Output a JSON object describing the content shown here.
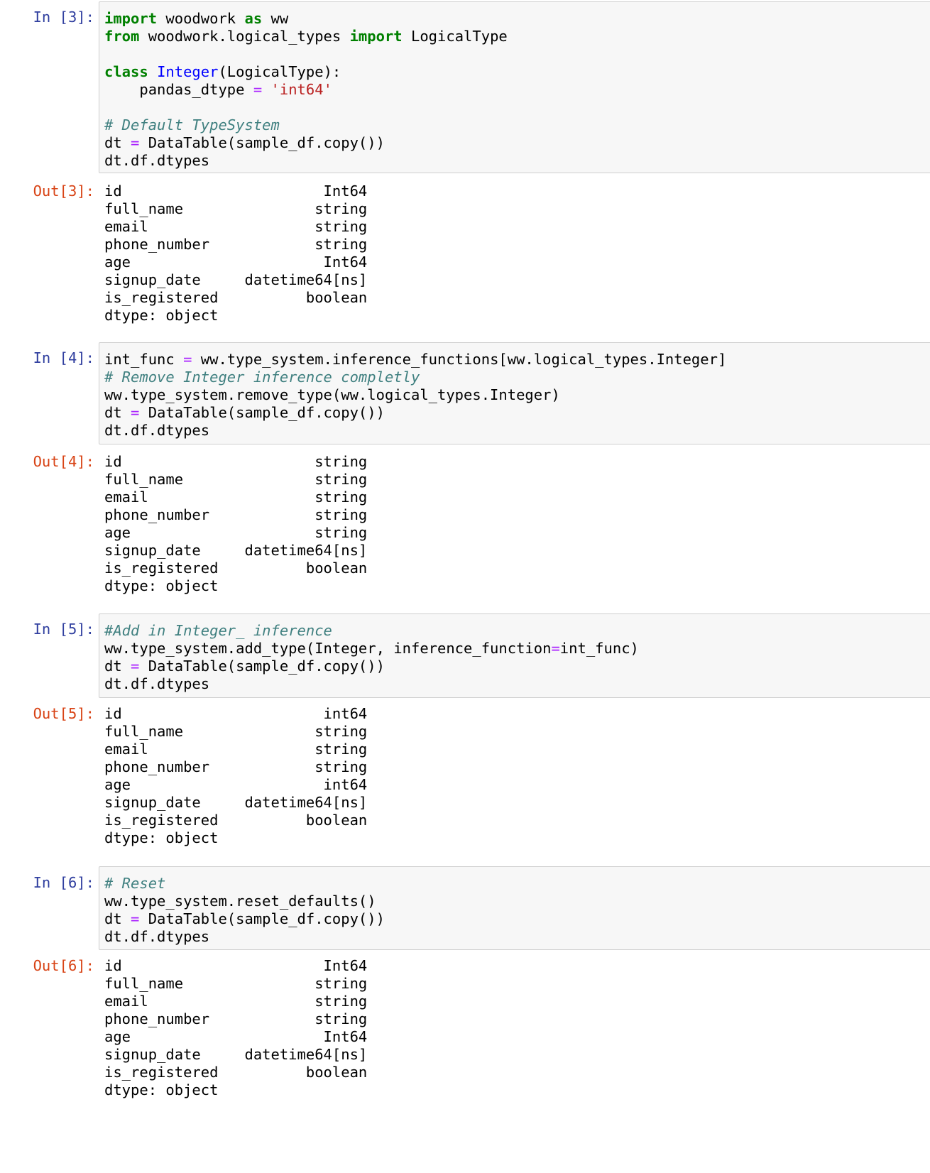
{
  "cells": [
    {
      "in_prompt": "In [3]:",
      "code": [
        "import woodwork as ww",
        "from woodwork.logical_types import LogicalType",
        "",
        "class Integer(LogicalType):",
        "    pandas_dtype = 'int64'",
        "",
        "# Default TypeSystem",
        "dt = DataTable(sample_df.copy())",
        "dt.df.dtypes"
      ],
      "out_prompt": "Out[3]:",
      "output": [
        "id                       Int64",
        "full_name               string",
        "email                   string",
        "phone_number            string",
        "age                      Int64",
        "signup_date     datetime64[ns]",
        "is_registered          boolean",
        "dtype: object"
      ]
    },
    {
      "in_prompt": "In [4]:",
      "code": [
        "int_func = ww.type_system.inference_functions[ww.logical_types.Integer]",
        "# Remove Integer inference completly",
        "ww.type_system.remove_type(ww.logical_types.Integer)",
        "dt = DataTable(sample_df.copy())",
        "dt.df.dtypes"
      ],
      "out_prompt": "Out[4]:",
      "output": [
        "id                      string",
        "full_name               string",
        "email                   string",
        "phone_number            string",
        "age                     string",
        "signup_date     datetime64[ns]",
        "is_registered          boolean",
        "dtype: object"
      ]
    },
    {
      "in_prompt": "In [5]:",
      "code": [
        "#Add in Integer_ inference",
        "ww.type_system.add_type(Integer, inference_function=int_func)",
        "dt = DataTable(sample_df.copy())",
        "dt.df.dtypes"
      ],
      "out_prompt": "Out[5]:",
      "output": [
        "id                       int64",
        "full_name               string",
        "email                   string",
        "phone_number            string",
        "age                      int64",
        "signup_date     datetime64[ns]",
        "is_registered          boolean",
        "dtype: object"
      ]
    },
    {
      "in_prompt": "In [6]:",
      "code": [
        "# Reset",
        "ww.type_system.reset_defaults()",
        "dt = DataTable(sample_df.copy())",
        "dt.df.dtypes"
      ],
      "out_prompt": "Out[6]:",
      "output": [
        "id                       Int64",
        "full_name               string",
        "email                   string",
        "phone_number            string",
        "age                      Int64",
        "signup_date     datetime64[ns]",
        "is_registered          boolean",
        "dtype: object"
      ]
    }
  ],
  "syntax_colors": {
    "keyword": "#008000",
    "class_name": "#0000ff",
    "operator": "#aa22ff",
    "string": "#ba2121",
    "comment": "#408080",
    "in_prompt": "#303f9f",
    "out_prompt": "#d84315"
  }
}
